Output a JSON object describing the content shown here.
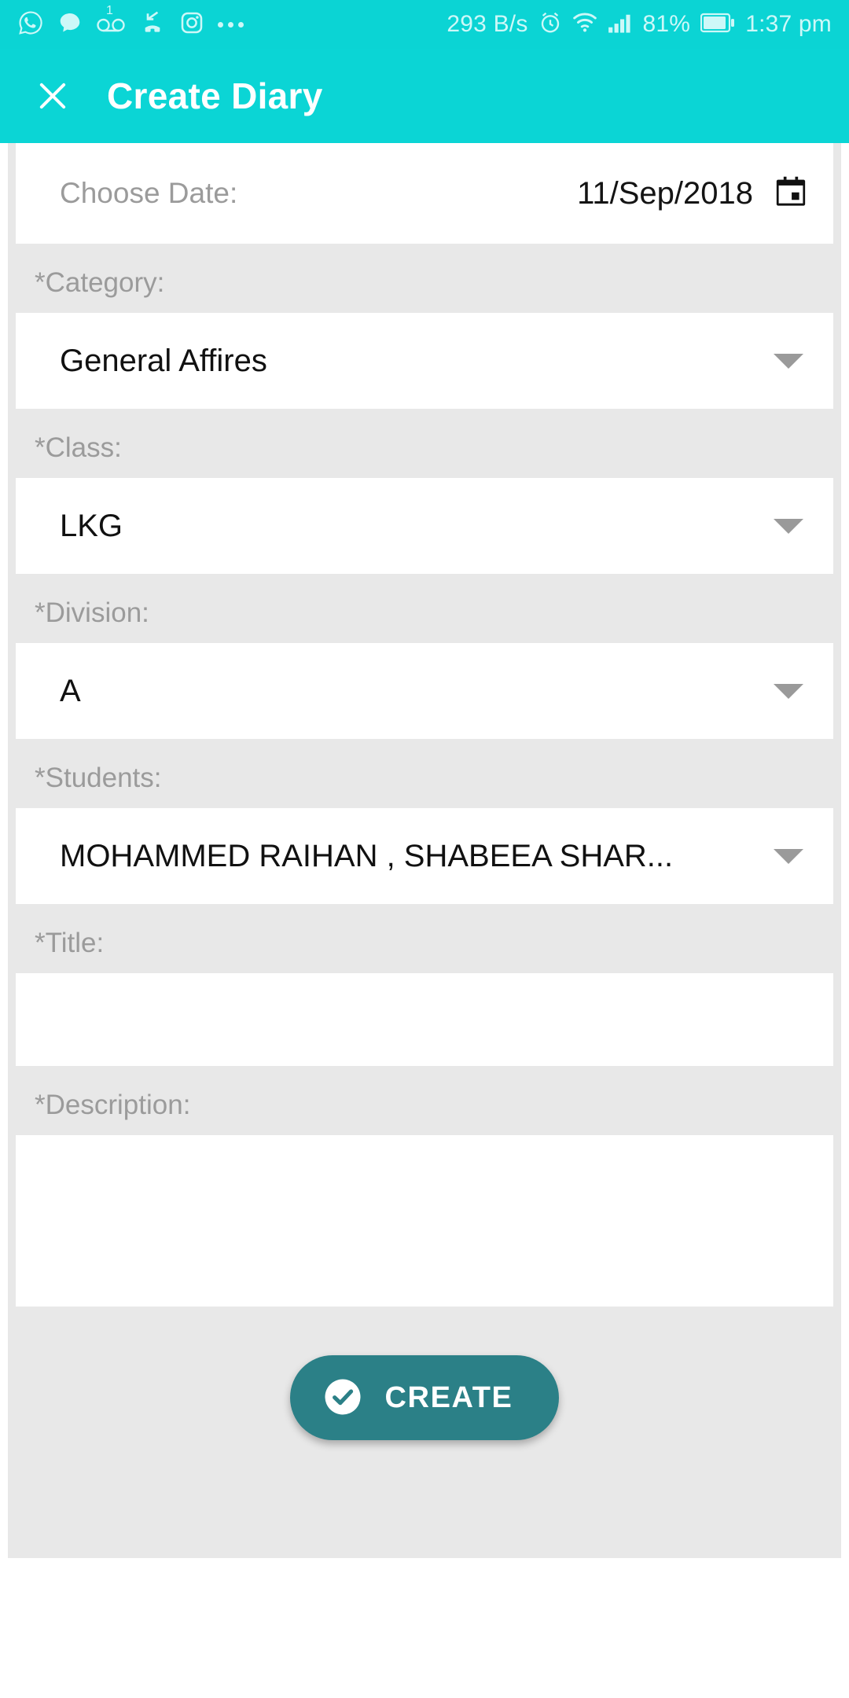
{
  "status_bar": {
    "network_speed": "293 B/s",
    "battery_percent": "81%",
    "time": "1:37 pm",
    "voicemail_badge": "1",
    "left_icons": [
      "whatsapp-icon",
      "message-bubble-icon",
      "voicemail-icon",
      "missed-call-icon",
      "instagram-icon",
      "more-dots-icon"
    ],
    "right_icons": [
      "alarm-icon",
      "wifi-icon",
      "signal-icon",
      "battery-icon"
    ]
  },
  "appbar": {
    "close_icon": "close-icon",
    "title": "Create Diary"
  },
  "form": {
    "date": {
      "label": "Choose Date:",
      "value": "11/Sep/2018",
      "icon": "calendar-icon"
    },
    "category": {
      "label": "*Category:",
      "value": "General Affires"
    },
    "class": {
      "label": "*Class:",
      "value": "LKG"
    },
    "division": {
      "label": "*Division:",
      "value": "A"
    },
    "students": {
      "label": "*Students:",
      "value": "MOHAMMED RAIHAN , SHABEEA SHAR..."
    },
    "title": {
      "label": "*Title:",
      "value": "",
      "placeholder": ""
    },
    "description": {
      "label": "*Description:",
      "value": "",
      "placeholder": ""
    }
  },
  "submit": {
    "label": "CREATE",
    "icon": "check-circle-icon"
  },
  "colors": {
    "appbar": "#0bd5d5",
    "statusbar": "#0bd4d4",
    "form_background": "#e8e8e8",
    "button": "#2b8087"
  }
}
